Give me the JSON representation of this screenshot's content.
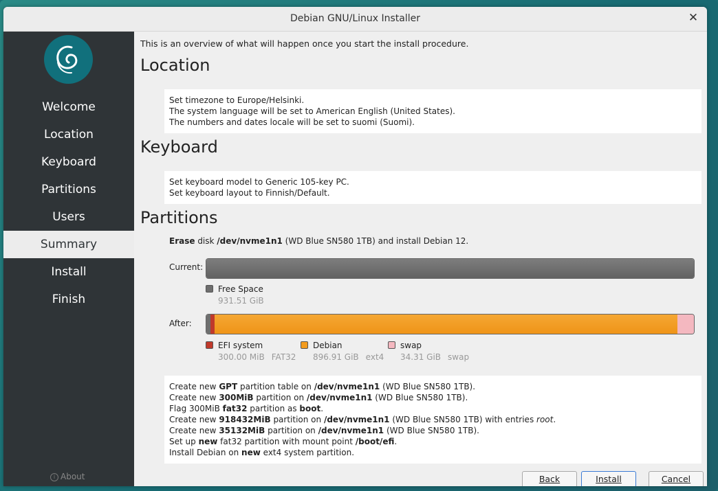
{
  "window": {
    "title": "Debian GNU/Linux Installer",
    "close_glyph": "✕"
  },
  "sidebar": {
    "items": [
      {
        "label": "Welcome",
        "active": false
      },
      {
        "label": "Location",
        "active": false
      },
      {
        "label": "Keyboard",
        "active": false
      },
      {
        "label": "Partitions",
        "active": false
      },
      {
        "label": "Users",
        "active": false
      },
      {
        "label": "Summary",
        "active": true
      },
      {
        "label": "Install",
        "active": false
      },
      {
        "label": "Finish",
        "active": false
      }
    ],
    "about": "About"
  },
  "summary": {
    "intro": "This is an overview of what will happen once you start the install procedure.",
    "location": {
      "heading": "Location",
      "lines": [
        "Set timezone to Europe/Helsinki.",
        "The system language will be set to American English (United States).",
        "The numbers and dates locale will be set to suomi (Suomi)."
      ]
    },
    "keyboard": {
      "heading": "Keyboard",
      "lines": [
        "Set keyboard model to Generic 105-key PC.",
        "Set keyboard layout to Finnish/Default."
      ]
    },
    "partitions": {
      "heading": "Partitions",
      "erase": {
        "bold1": "Erase",
        "t1": " disk ",
        "bold2": "/dev/nvme1n1",
        "t2": " (WD Blue SN580 1TB) and install Debian 12."
      },
      "current_label": "Current:",
      "after_label": "After:",
      "current_legend": [
        {
          "name": "Free Space",
          "size": "931.51 GiB",
          "fs": "",
          "color": "#6e6e6e"
        }
      ],
      "after_legend": [
        {
          "name": "EFI system",
          "size": "300.00 MiB",
          "fs": "FAT32",
          "color": "#c0392b"
        },
        {
          "name": "Debian",
          "size": "896.91 GiB",
          "fs": "ext4",
          "color": "#f39c1f"
        },
        {
          "name": "swap",
          "size": "34.31 GiB",
          "fs": "swap",
          "color": "#f4b8c0"
        }
      ],
      "ops": [
        [
          {
            "t": "Create new "
          },
          {
            "b": "GPT"
          },
          {
            "t": " partition table on "
          },
          {
            "b": "/dev/nvme1n1"
          },
          {
            "t": " (WD Blue SN580 1TB)."
          }
        ],
        [
          {
            "t": "Create new "
          },
          {
            "b": "300MiB"
          },
          {
            "t": " partition on "
          },
          {
            "b": "/dev/nvme1n1"
          },
          {
            "t": " (WD Blue SN580 1TB)."
          }
        ],
        [
          {
            "t": "Flag 300MiB "
          },
          {
            "b": "fat32"
          },
          {
            "t": " partition as "
          },
          {
            "b": "boot"
          },
          {
            "t": "."
          }
        ],
        [
          {
            "t": "Create new "
          },
          {
            "b": "918432MiB"
          },
          {
            "t": " partition on "
          },
          {
            "b": "/dev/nvme1n1"
          },
          {
            "t": " (WD Blue SN580 1TB) with entries "
          },
          {
            "i": "root"
          },
          {
            "t": "."
          }
        ],
        [
          {
            "t": "Create new "
          },
          {
            "b": "35132MiB"
          },
          {
            "t": " partition on "
          },
          {
            "b": "/dev/nvme1n1"
          },
          {
            "t": " (WD Blue SN580 1TB)."
          }
        ],
        [
          {
            "t": "Set up "
          },
          {
            "b": "new"
          },
          {
            "t": " fat32 partition with mount point "
          },
          {
            "b": "/boot/efi"
          },
          {
            "t": "."
          }
        ],
        [
          {
            "t": "Install Debian on "
          },
          {
            "b": "new"
          },
          {
            "t": " ext4 system partition."
          }
        ]
      ]
    }
  },
  "buttons": {
    "back": "Back",
    "install": "Install",
    "cancel": "Cancel"
  },
  "colors": {
    "desktop": "#1b6e74",
    "sidebar": "#2f3437",
    "accent": "#11707c",
    "free": "#6e6e6e",
    "efi": "#c0392b",
    "debian": "#f39c1f",
    "swap": "#f4b8c0"
  }
}
